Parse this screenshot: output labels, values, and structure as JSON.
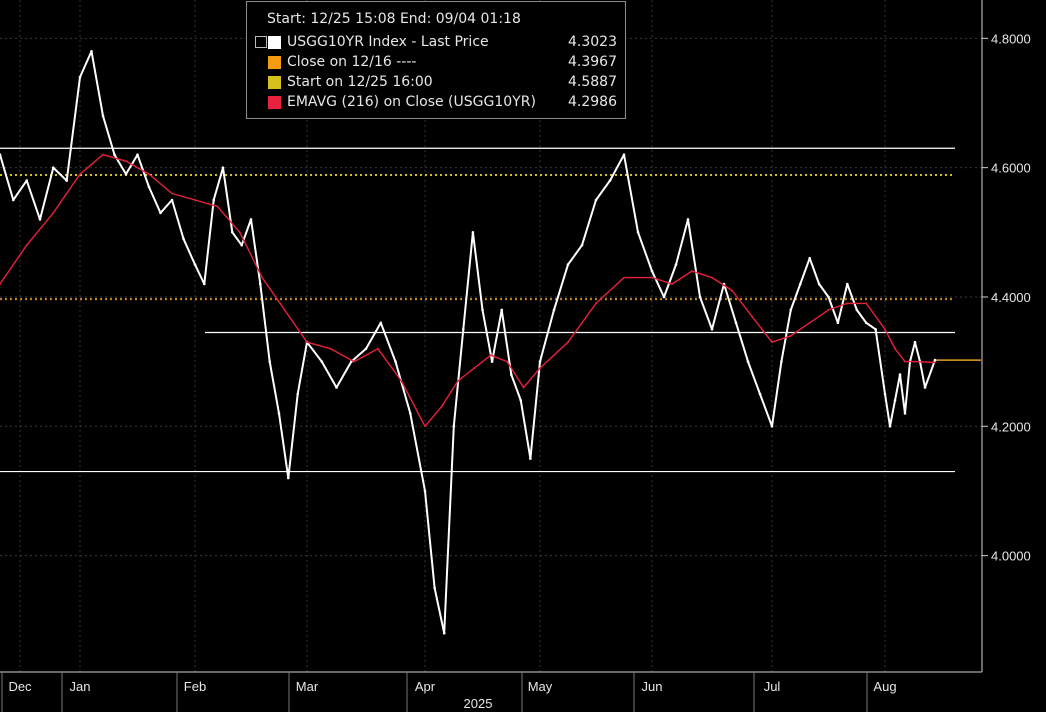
{
  "legend": {
    "header": "Start: 12/25 15:08 End: 09/04 01:18",
    "items": [
      {
        "label": "USGG10YR Index - Last Price",
        "value": "4.3023",
        "color": "#ffffff"
      },
      {
        "label": "Close on 12/16 ----",
        "value": "4.3967",
        "color": "#f39c12"
      },
      {
        "label": "Start on 12/25 16:00",
        "value": "4.5887",
        "color": "#d4c21a"
      },
      {
        "label": "EMAVG (216)  on Close (USGG10YR)",
        "value": "4.2986",
        "color": "#e8213c"
      }
    ]
  },
  "chart_data": {
    "type": "line",
    "y_ticks": [
      "4.0000",
      "4.2000",
      "4.4000",
      "4.6000",
      "4.8000"
    ],
    "y_tick_values": [
      4.0,
      4.2,
      4.4,
      4.6,
      4.8
    ],
    "ylim": [
      3.82,
      4.85
    ],
    "x_tick_labels": [
      "Dec",
      "Jan",
      "Feb",
      "Mar",
      "Apr",
      "May",
      "Jun",
      "Jul",
      "Aug"
    ],
    "year_label": "2025",
    "grid": true,
    "legend_position": "top-left",
    "reference_lines": [
      {
        "name": "Close on 12/16",
        "value": 4.3967,
        "style": "dotted",
        "color": "#c98a1a"
      },
      {
        "name": "Start on 12/25 16:00",
        "value": 4.5887,
        "style": "dotted",
        "color": "#d4c21a"
      },
      {
        "name": "horizontal line",
        "value": 4.63,
        "style": "solid",
        "color": "#ffffff"
      },
      {
        "name": "horizontal line",
        "value": 4.345,
        "style": "solid",
        "color": "#ffffff",
        "starts_at": "Feb"
      },
      {
        "name": "horizontal line",
        "value": 4.13,
        "style": "solid",
        "color": "#ffffff"
      }
    ],
    "last_value_line": {
      "value": 4.3023,
      "color": "#e69b23"
    },
    "series": [
      {
        "name": "USGG10YR Index - Last Price",
        "color": "#ffffff",
        "points": [
          [
            "Dec",
            4.62
          ],
          [
            "Dec",
            4.55
          ],
          [
            "Dec",
            4.58
          ],
          [
            "Dec",
            4.52
          ],
          [
            "Dec",
            4.6
          ],
          [
            "Dec",
            4.58
          ],
          [
            "Jan",
            4.74
          ],
          [
            "Jan",
            4.78
          ],
          [
            "Jan",
            4.68
          ],
          [
            "Jan",
            4.62
          ],
          [
            "Jan",
            4.59
          ],
          [
            "Jan",
            4.62
          ],
          [
            "Jan",
            4.57
          ],
          [
            "Jan",
            4.53
          ],
          [
            "Jan",
            4.55
          ],
          [
            "Jan",
            4.49
          ],
          [
            "Feb",
            4.45
          ],
          [
            "Feb",
            4.42
          ],
          [
            "Feb",
            4.55
          ],
          [
            "Feb",
            4.6
          ],
          [
            "Feb",
            4.5
          ],
          [
            "Feb",
            4.48
          ],
          [
            "Feb",
            4.52
          ],
          [
            "Feb",
            4.42
          ],
          [
            "Feb",
            4.3
          ],
          [
            "Feb",
            4.22
          ],
          [
            "Feb",
            4.12
          ],
          [
            "Feb",
            4.25
          ],
          [
            "Mar",
            4.33
          ],
          [
            "Mar",
            4.3
          ],
          [
            "Mar",
            4.26
          ],
          [
            "Mar",
            4.3
          ],
          [
            "Mar",
            4.32
          ],
          [
            "Mar",
            4.36
          ],
          [
            "Mar",
            4.3
          ],
          [
            "Mar",
            4.22
          ],
          [
            "Apr",
            4.1
          ],
          [
            "Apr",
            3.95
          ],
          [
            "Apr",
            3.88
          ],
          [
            "Apr",
            4.2
          ],
          [
            "Apr",
            4.35
          ],
          [
            "Apr",
            4.5
          ],
          [
            "Apr",
            4.38
          ],
          [
            "Apr",
            4.3
          ],
          [
            "Apr",
            4.38
          ],
          [
            "Apr",
            4.28
          ],
          [
            "Apr",
            4.24
          ],
          [
            "Apr",
            4.15
          ],
          [
            "May",
            4.3
          ],
          [
            "May",
            4.38
          ],
          [
            "May",
            4.45
          ],
          [
            "May",
            4.48
          ],
          [
            "May",
            4.55
          ],
          [
            "May",
            4.58
          ],
          [
            "May",
            4.62
          ],
          [
            "May",
            4.5
          ],
          [
            "Jun",
            4.44
          ],
          [
            "Jun",
            4.4
          ],
          [
            "Jun",
            4.45
          ],
          [
            "Jun",
            4.52
          ],
          [
            "Jun",
            4.4
          ],
          [
            "Jun",
            4.35
          ],
          [
            "Jun",
            4.42
          ],
          [
            "Jun",
            4.36
          ],
          [
            "Jun",
            4.3
          ],
          [
            "Jun",
            4.25
          ],
          [
            "Jul",
            4.2
          ],
          [
            "Jul",
            4.3
          ],
          [
            "Jul",
            4.38
          ],
          [
            "Jul",
            4.42
          ],
          [
            "Jul",
            4.46
          ],
          [
            "Jul",
            4.42
          ],
          [
            "Jul",
            4.4
          ],
          [
            "Jul",
            4.36
          ],
          [
            "Jul",
            4.42
          ],
          [
            "Jul",
            4.38
          ],
          [
            "Jul",
            4.36
          ],
          [
            "Jul",
            4.35
          ],
          [
            "Aug",
            4.25
          ],
          [
            "Aug",
            4.2
          ],
          [
            "Aug",
            4.24
          ],
          [
            "Aug",
            4.28
          ],
          [
            "Aug",
            4.22
          ],
          [
            "Aug",
            4.3
          ],
          [
            "Aug",
            4.33
          ],
          [
            "Aug",
            4.3
          ],
          [
            "Aug",
            4.26
          ],
          [
            "Aug",
            4.3023
          ]
        ]
      },
      {
        "name": "EMAVG (216)  on Close (USGG10YR)",
        "color": "#e8213c",
        "points": [
          [
            "Dec",
            4.42
          ],
          [
            "Dec",
            4.48
          ],
          [
            "Dec",
            4.53
          ],
          [
            "Jan",
            4.59
          ],
          [
            "Jan",
            4.62
          ],
          [
            "Jan",
            4.61
          ],
          [
            "Jan",
            4.59
          ],
          [
            "Jan",
            4.56
          ],
          [
            "Feb",
            4.55
          ],
          [
            "Feb",
            4.54
          ],
          [
            "Feb",
            4.5
          ],
          [
            "Feb",
            4.43
          ],
          [
            "Feb",
            4.38
          ],
          [
            "Mar",
            4.33
          ],
          [
            "Mar",
            4.32
          ],
          [
            "Mar",
            4.3
          ],
          [
            "Mar",
            4.32
          ],
          [
            "Mar",
            4.27
          ],
          [
            "Apr",
            4.2
          ],
          [
            "Apr",
            4.23
          ],
          [
            "Apr",
            4.27
          ],
          [
            "Apr",
            4.29
          ],
          [
            "Apr",
            4.31
          ],
          [
            "Apr",
            4.3
          ],
          [
            "Apr",
            4.26
          ],
          [
            "May",
            4.29
          ],
          [
            "May",
            4.33
          ],
          [
            "May",
            4.39
          ],
          [
            "May",
            4.43
          ],
          [
            "Jun",
            4.43
          ],
          [
            "Jun",
            4.42
          ],
          [
            "Jun",
            4.44
          ],
          [
            "Jun",
            4.43
          ],
          [
            "Jun",
            4.41
          ],
          [
            "Jun",
            4.37
          ],
          [
            "Jul",
            4.33
          ],
          [
            "Jul",
            4.34
          ],
          [
            "Jul",
            4.36
          ],
          [
            "Jul",
            4.38
          ],
          [
            "Jul",
            4.39
          ],
          [
            "Jul",
            4.39
          ],
          [
            "Aug",
            4.35
          ],
          [
            "Aug",
            4.32
          ],
          [
            "Aug",
            4.3
          ],
          [
            "Aug",
            4.3
          ],
          [
            "Aug",
            4.2986
          ]
        ]
      }
    ]
  }
}
